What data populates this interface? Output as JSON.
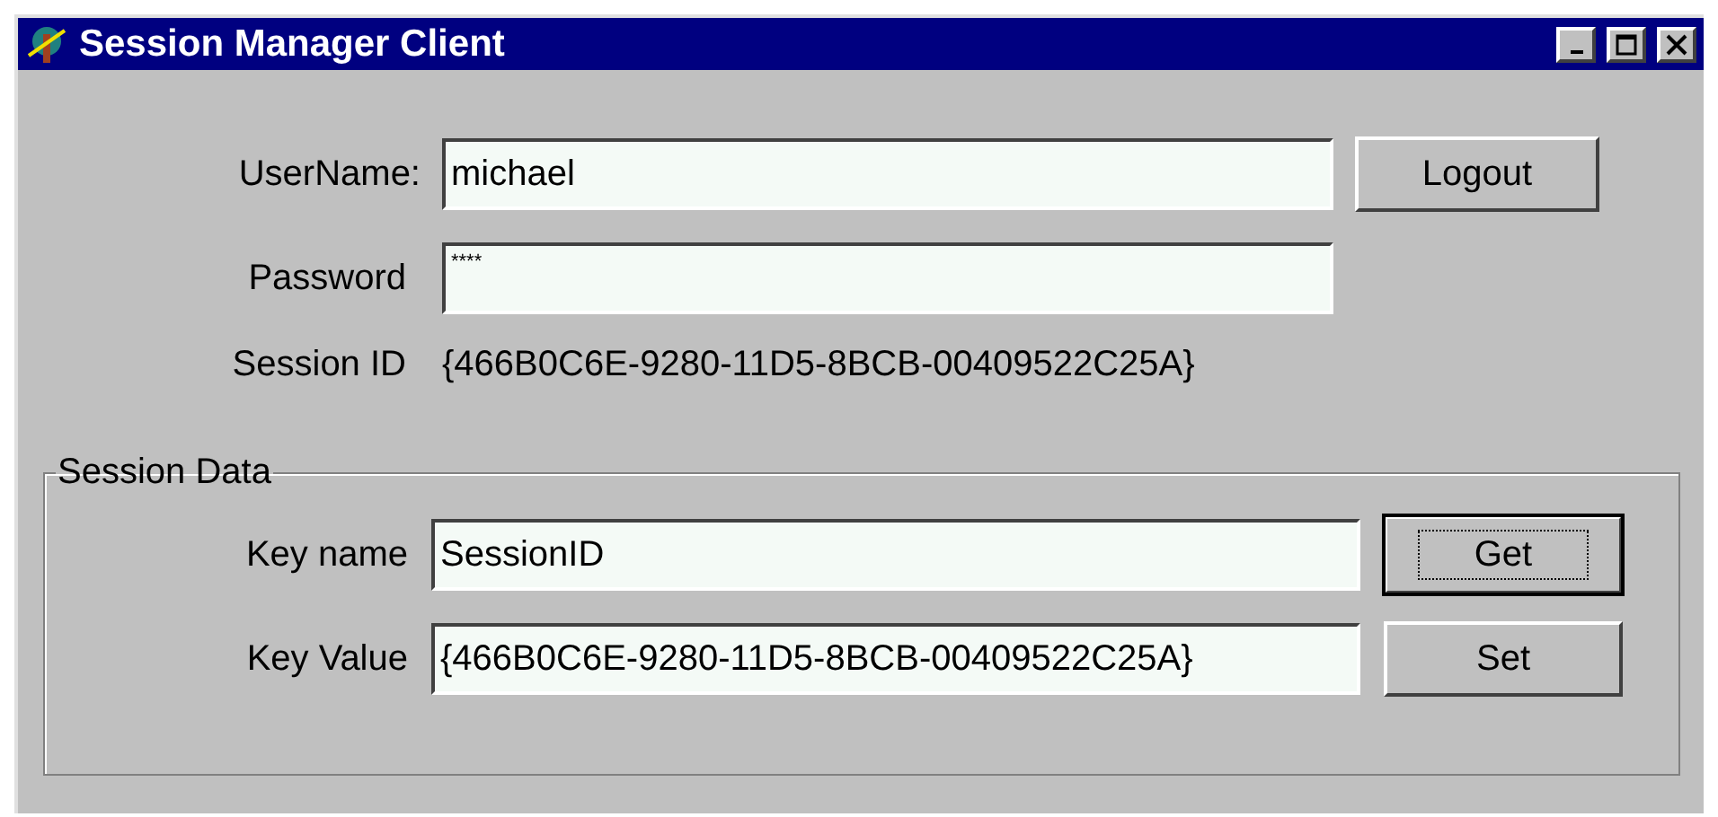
{
  "window": {
    "title": "Session Manager Client"
  },
  "login": {
    "username": {
      "label": "UserName:",
      "value": "michael"
    },
    "password": {
      "label": "Password",
      "value": "****"
    },
    "logout_button": "Logout",
    "session_id": {
      "label": "Session ID",
      "value": "{466B0C6E-9280-11D5-8BCB-00409522C25A}"
    }
  },
  "session_data": {
    "title": "Session Data",
    "rows": [
      {
        "label": "Key name",
        "value": "SessionID",
        "button": "Get",
        "default": true
      },
      {
        "label": "Key Value",
        "value": "{466B0C6E-9280-11D5-8BCB-00409522C25A}",
        "button": "Set",
        "default": false
      }
    ]
  }
}
